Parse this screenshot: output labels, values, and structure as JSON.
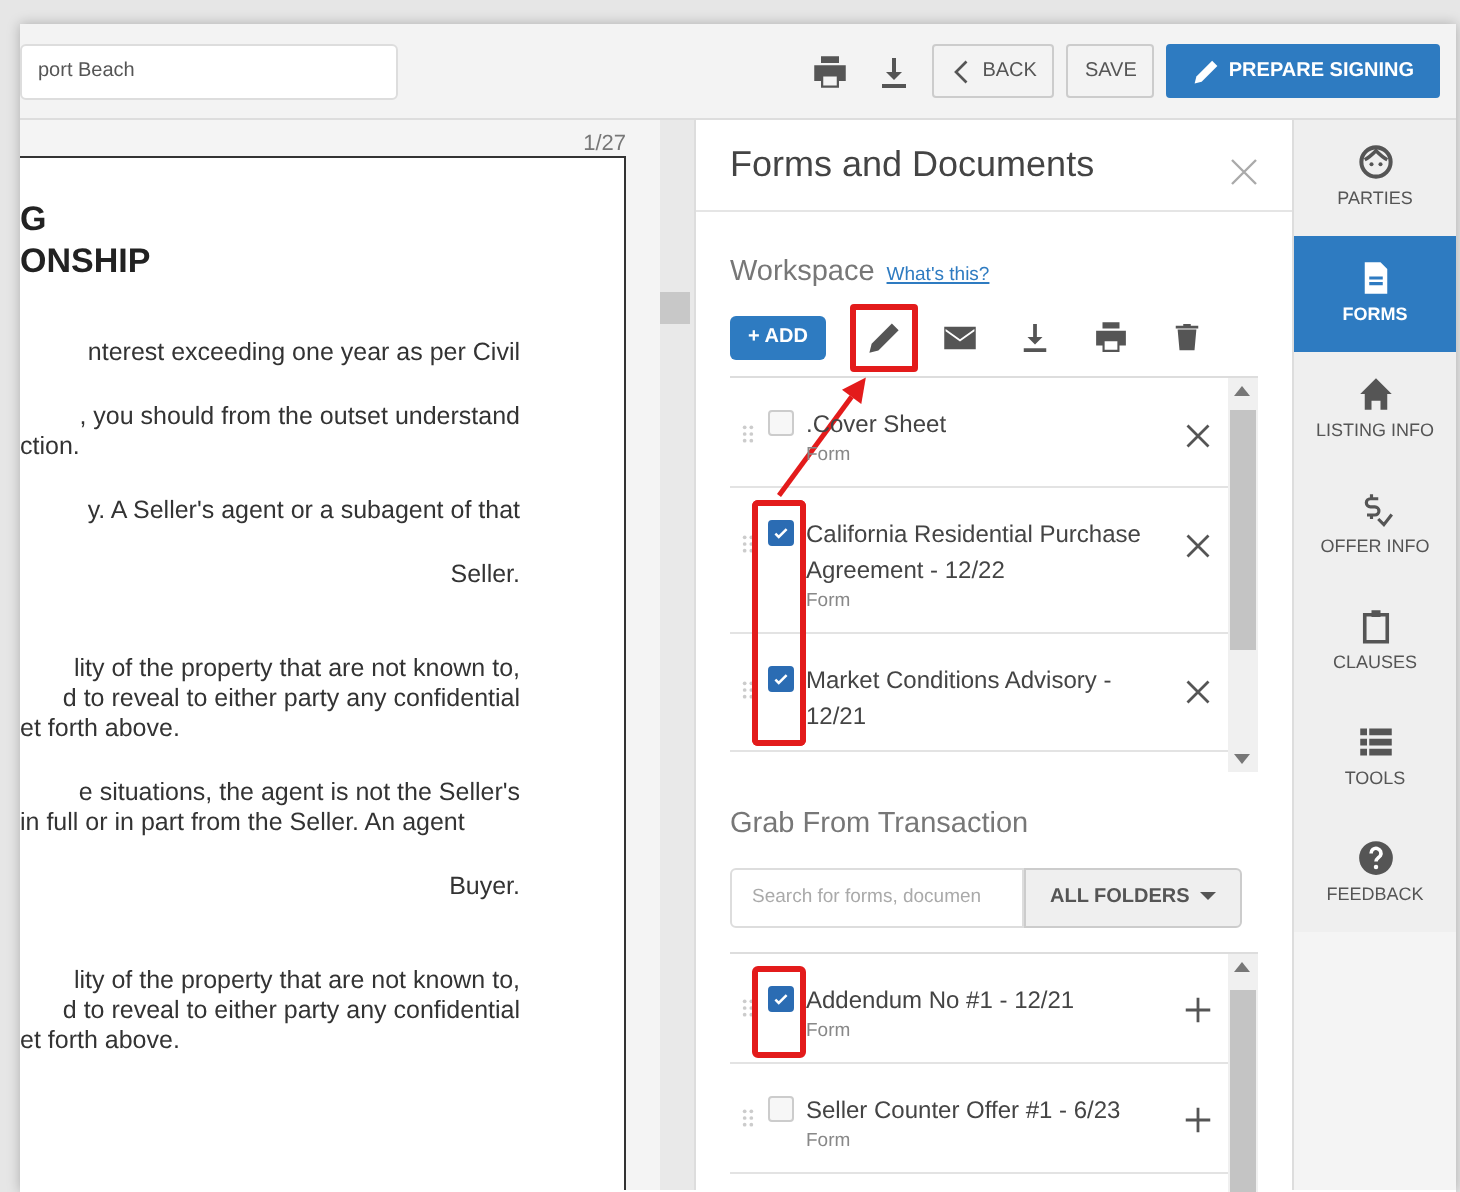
{
  "topbar": {
    "search": {
      "value": "port Beach"
    },
    "buttons": [
      {
        "label": "BACK",
        "kind": "back"
      },
      {
        "label": "SAVE",
        "kind": "plain"
      },
      {
        "label": "PREPARE SIGNING",
        "kind": "primary"
      }
    ]
  },
  "document": {
    "page_number": "1/27",
    "heading": [
      "G",
      "ONSHIP"
    ],
    "paragraphs": [
      {
        "kind": "section",
        "lines": [
          "nterest exceeding one year as per Civil"
        ]
      },
      {
        "kind": "para",
        "lines": [
          ", you should from the outset understand",
          "ction."
        ]
      },
      {
        "kind": "para",
        "lines": [
          "y. A Seller's agent or a subagent of that"
        ]
      },
      {
        "kind": "para",
        "lines": [
          "Seller."
        ]
      },
      {
        "kind": "section",
        "lines": [
          "lity of the property that are not known to,",
          "d to reveal to either party any confidential",
          "et forth above."
        ]
      },
      {
        "kind": "para",
        "lines": [
          "e situations, the agent is not the Seller's",
          "in full or in part from the Seller. An agent"
        ]
      },
      {
        "kind": "para",
        "lines": [
          "Buyer."
        ]
      },
      {
        "kind": "section",
        "lines": [
          "lity of the property that are not known to,",
          "d to reveal to either party any confidential",
          "et forth above."
        ]
      }
    ]
  },
  "panel": {
    "title": "Forms and Documents",
    "workspace": {
      "label": "Workspace",
      "help_link": "What's this?",
      "add_button": "+ ADD",
      "arrow": true,
      "tools": [
        {
          "highlighted": true
        },
        {
          "highlighted": false
        },
        {
          "highlighted": false
        },
        {
          "highlighted": false
        },
        {
          "highlighted": false
        }
      ],
      "items": [
        {
          "title": ".Cover Sheet",
          "subtitle": "Form",
          "checked": false,
          "highlighted": false
        },
        {
          "title": "California Residential Purchase Agreement - 12/22",
          "subtitle": "Form",
          "checked": true,
          "highlighted": true
        },
        {
          "title": "Market Conditions Advisory - 12/21",
          "checked": true,
          "highlighted": true
        }
      ]
    },
    "grab": {
      "label": "Grab From Transaction",
      "search_placeholder": "Search for forms, documen",
      "folder_button": "ALL FOLDERS",
      "items": [
        {
          "title": "Addendum No #1 - 12/21",
          "subtitle": "Form",
          "checked": true,
          "highlighted": true
        },
        {
          "title": "Seller Counter Offer #1 - 6/23",
          "subtitle": "Form",
          "checked": false,
          "highlighted": false
        }
      ]
    }
  },
  "sidebar": [
    {
      "label": "PARTIES",
      "selected": false
    },
    {
      "label": "FORMS",
      "selected": true
    },
    {
      "label": "LISTING INFO",
      "selected": false
    },
    {
      "label": "OFFER INFO",
      "selected": false
    },
    {
      "label": "CLAUSES",
      "selected": false
    },
    {
      "label": "TOOLS",
      "selected": false
    },
    {
      "label": "FEEDBACK",
      "selected": false
    }
  ]
}
